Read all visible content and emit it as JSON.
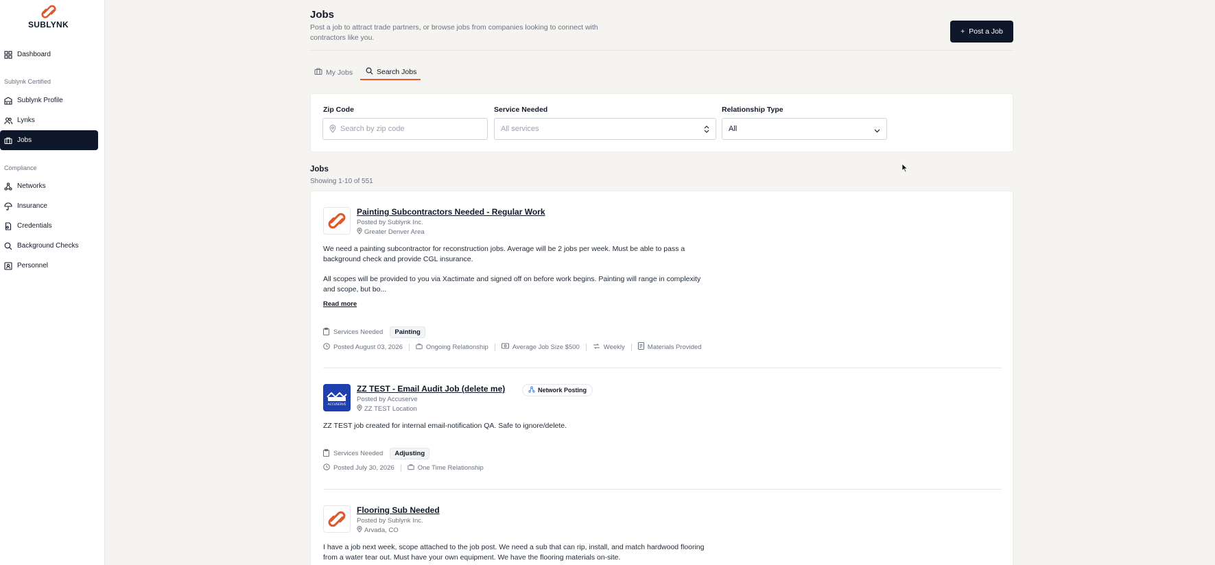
{
  "brand": {
    "name": "SUBLYNK",
    "accent": "#e0572a",
    "dark": "#0f172a"
  },
  "sidebar": {
    "dashboard": "Dashboard",
    "section_certified": "Sublynk Certified",
    "profile": "Sublynk Profile",
    "lynks": "Lynks",
    "jobs": "Jobs",
    "section_compliance": "Compliance",
    "networks": "Networks",
    "insurance": "Insurance",
    "credentials": "Credentials",
    "background_checks": "Background Checks",
    "personnel": "Personnel"
  },
  "header": {
    "title": "Jobs",
    "subtitle": "Post a job to attract trade partners, or browse jobs from companies looking to connect with contractors like you.",
    "post_button": "Post a Job"
  },
  "tabs": {
    "my_jobs": "My Jobs",
    "search_jobs": "Search Jobs"
  },
  "filters": {
    "zip_label": "Zip Code",
    "zip_placeholder": "Search by zip code",
    "service_label": "Service Needed",
    "service_value": "All services",
    "relationship_label": "Relationship Type",
    "relationship_value": "All"
  },
  "list": {
    "title": "Jobs",
    "count": "Showing 1-10 of 551"
  },
  "jobs": [
    {
      "title": "Painting Subcontractors Needed - Regular Work",
      "posted_by": "Posted by Sublynk Inc.",
      "location": "Greater Denver Area",
      "desc1": "We need a painting subcontractor for reconstruction jobs. Average will be 2 jobs per week. Must be able to pass a background check and provide CGL insurance.",
      "desc2": "All scopes will be provided to you via Xactimate and signed off on before work begins. Painting will range in complexity and scope, but bo...",
      "read_more": "Read more",
      "services_label": "Services Needed",
      "service": "Painting",
      "posted": "Posted August 03, 2026",
      "relationship": "Ongoing Relationship",
      "avg_size": "Average Job Size $500",
      "frequency": "Weekly",
      "materials": "Materials Provided"
    },
    {
      "title": "ZZ TEST - Email Audit Job (delete me)",
      "badge": "Network Posting",
      "posted_by": "Posted by Accuserve",
      "location": "ZZ TEST Location",
      "desc1": "ZZ TEST job created for internal email-notification QA. Safe to ignore/delete.",
      "services_label": "Services Needed",
      "service": "Adjusting",
      "posted": "Posted July 30, 2026",
      "relationship": "One Time Relationship",
      "logo_text": "ACCUSERVE"
    },
    {
      "title": "Flooring Sub Needed",
      "posted_by": "Posted by Sublynk Inc.",
      "location": "Arvada, CO",
      "desc1": "I have a job next week, scope attached to the job post. We need a sub that can rip, install, and match hardwood flooring from a water tear out. Must have your own equipment. We have the flooring materials on-site."
    }
  ]
}
